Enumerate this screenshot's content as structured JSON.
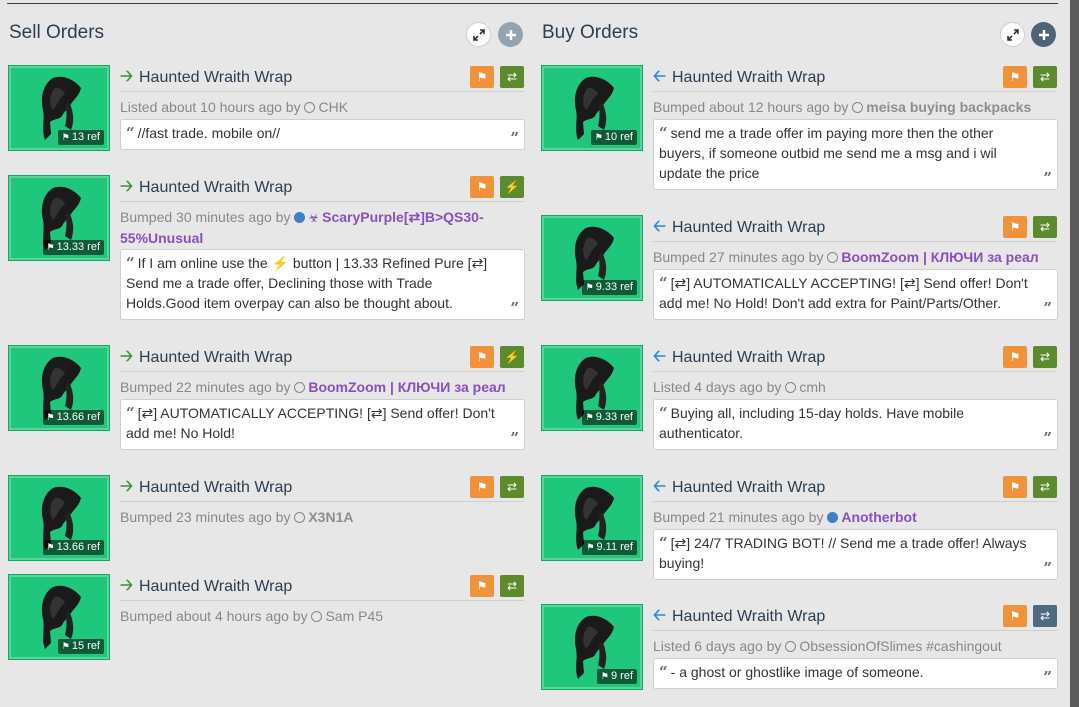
{
  "sell": {
    "title": "Sell Orders",
    "listings": [
      {
        "name": "Haunted Wraith Wrap",
        "price": "13 ref",
        "action_icon": "trade-icon",
        "action_glyph": "⇄",
        "status": "Listed about 10 hours ago by",
        "user": "CHK",
        "user_style": "plain",
        "user_marker": "circle",
        "quote": "//fast trade. mobile on//"
      },
      {
        "name": "Haunted Wraith Wrap",
        "price": "13.33 ref",
        "action_icon": "lightning-icon",
        "action_glyph": "⚡",
        "status": "Bumped 30 minutes ago by",
        "user": "ScaryPurple[⇄]B>QS30-55%Unusual",
        "user_style": "purple",
        "user_marker": "dot",
        "quote": "If I am online use the ⚡ button | 13.33 Refined Pure [⇄] Send me a trade offer, Declining those with Trade Holds.Good item overpay can also be thought about."
      },
      {
        "name": "Haunted Wraith Wrap",
        "price": "13.66 ref",
        "action_icon": "lightning-icon",
        "action_glyph": "⚡",
        "status": "Bumped 22 minutes ago by",
        "user": "BoomZoom | КЛЮЧИ за реал",
        "user_style": "purple",
        "user_marker": "circle",
        "quote": "[⇄] AUTOMATICALLY ACCEPTING! [⇄] Send offer! Don't add me! No Hold!"
      },
      {
        "name": "Haunted Wraith Wrap",
        "price": "13.66 ref",
        "action_icon": "trade-icon",
        "action_glyph": "⇄",
        "status": "Bumped 23 minutes ago by",
        "user": "X3N1A",
        "user_style": "bold",
        "user_marker": "circle",
        "quote": ""
      },
      {
        "name": "Haunted Wraith Wrap",
        "price": "15 ref",
        "action_icon": "trade-icon",
        "action_glyph": "⇄",
        "status": "Bumped about 4 hours ago by",
        "user": "Sam P45",
        "user_style": "plain",
        "user_marker": "circle",
        "quote": ""
      }
    ]
  },
  "buy": {
    "title": "Buy Orders",
    "listings": [
      {
        "name": "Haunted Wraith Wrap",
        "price": "10 ref",
        "action_icon": "trade-icon",
        "action_glyph": "⇄",
        "status": "Bumped about 12 hours ago by",
        "user": "meisa buying backpacks",
        "user_style": "bold",
        "user_marker": "circle",
        "quote": "send me a trade offer im paying more then the other buyers, if someone outbid me send me a msg and i wil update the price"
      },
      {
        "name": "Haunted Wraith Wrap",
        "price": "9.33 ref",
        "action_icon": "trade-icon",
        "action_glyph": "⇄",
        "status": "Bumped 27 minutes ago by",
        "user": "BoomZoom | КЛЮЧИ за реал",
        "user_style": "purple",
        "user_marker": "circle",
        "quote": "[⇄] AUTOMATICALLY ACCEPTING! [⇄] Send offer! Don't add me! No Hold! Don't add extra for Paint/Parts/Other."
      },
      {
        "name": "Haunted Wraith Wrap",
        "price": "9.33 ref",
        "action_icon": "trade-icon",
        "action_glyph": "⇄",
        "status": "Listed 4 days ago by",
        "user": "cmh",
        "user_style": "plain",
        "user_marker": "circle",
        "quote": "Buying all, including 15-day holds. Have mobile authenticator."
      },
      {
        "name": "Haunted Wraith Wrap",
        "price": "9.11 ref",
        "action_icon": "trade-icon",
        "action_glyph": "⇄",
        "status": "Bumped 21 minutes ago by",
        "user": "Anotherbot",
        "user_style": "purple",
        "user_marker": "dot",
        "quote": "[⇄] 24/7 TRADING BOT! // Send me a trade offer! Always buying!"
      },
      {
        "name": "Haunted Wraith Wrap",
        "price": "9 ref",
        "action_icon": "trade-icon",
        "action_glyph": "⇄",
        "status": "Listed 6 days ago by",
        "user": "ObsessionOfSlimes #cashingout",
        "user_style": "plain",
        "user_marker": "circle",
        "quote": "- a ghost or ghostlike image of someone."
      }
    ]
  },
  "colors": {
    "item_bg": "#1ec77b",
    "flag": "#f0923c",
    "trade": "#5c8a2c",
    "purple_user": "#8a4fbd",
    "buy_arrow": "#2a8bd0",
    "sell_arrow": "#3f8f3f"
  }
}
